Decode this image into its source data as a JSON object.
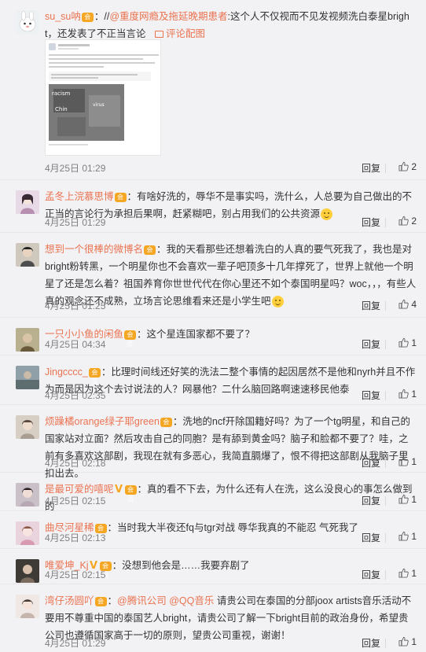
{
  "ui": {
    "reply_label": "回复",
    "accent": "#eb7350",
    "emoji_icon": "smile-emoji-icon"
  },
  "comments": [
    {
      "user": "su_su呐",
      "badge": "会员",
      "text_pre": "：//",
      "mention": "@重度网瘾及拖延晚期患者",
      "text": ":这个人不仅视而不见发视频洗白泰星bright，还发表了不正当言论",
      "pic_link": "评论配图",
      "time": "4月25日 01:29",
      "likes": "2"
    },
    {
      "user": "孟冬上浣慕思博",
      "badge": "会员",
      "text": "：有啥好洗的，辱华不是事实吗，洗什么，人总要为自己做出的不正当的言论行为承担后果啊，赶紧糊吧，别占用我们的公共资源",
      "time": "4月25日 01:29",
      "likes": "2"
    },
    {
      "user": "想到一个很棒的微博名",
      "badge": "会员",
      "text": "：我的天看那些还想着洗白的人真的要气死我了，我也是对bright粉转黑，一个明星你也不会喜欢一辈子吧顶多十几年撑死了，世界上就他一个明星了还是怎么着？祖国养育你世世代代在你心里还不如个泰国明星吗？woc，，，有些人真的观念还不成熟，立场言论思维看来还是小学生吧",
      "time": "4月25日 01:25",
      "likes": "4"
    },
    {
      "user": "一只小小鱼的闲鱼",
      "badge": "会员",
      "text": "：这个星连国家都不要了？",
      "time": "4月25日 04:34",
      "likes": "1"
    },
    {
      "user": "Jingcccc_",
      "badge": "会员",
      "text": "：比理时间线还好笑的洗法二整个事情的起因居然不是他和nyrh并且不作为而是因为这个去讨说法的人？网暴他？二什么脑回路啊速速移民他泰",
      "time": "4月25日 02:35",
      "likes": "1"
    },
    {
      "user": "烦躁橘orange绿子耶green",
      "badge": "会员",
      "text": "：洗地的ncf开除国籍好吗？为了一个tg明星，和自己的国家站对立面？然后攻击自己的同胞？是有舔到黄金吗？脑子和脸都不要了？哇，之前有多喜欢这部剧，我现在就有多恶心，我简直膈爆了，恨不得把这部剧从我脑子里扣出去。",
      "time": "4月25日 02:18",
      "likes": "1"
    },
    {
      "user": "是最可爱的嘻呢",
      "badge": "会员",
      "vip": "V",
      "text": "：真的看不下去，为什么还有人在洗，这么没良心的事怎么做到的",
      "time": "4月25日 02:15",
      "likes": "1"
    },
    {
      "user": "曲尽河星稀",
      "badge": "会员",
      "text": "：当时我大半夜还fq与tgr对战 辱华我真的不能忍 气死我了",
      "time": "4月25日 02:13",
      "likes": "1"
    },
    {
      "user": "唯爱坤_Kj",
      "badge": "会员",
      "vip": "V",
      "text": "：没想到他会是……我要弃剧了",
      "time": "4月25日 02:15",
      "likes": "1"
    },
    {
      "user": "湾仔汤圆吖",
      "badge": "会员",
      "text_pre": "：",
      "mention": "@腾讯公司",
      "mention2": "@QQ音乐",
      "text": " 请贵公司在泰国的分部joox artists音乐活动不要用不尊重中国的泰国艺人bright，请贵公司了解一下bright目前的政治身份，希望贵公司也遵循国家高于一切的原则，望贵公司重视，谢谢！",
      "time": "4月25日 01:29",
      "likes": "1"
    }
  ],
  "screenshot": {
    "lines": [
      "【正义提醒】网友反映，最近BTS的MV（新歌）中出现辱华内容，请大家注意辨别！",
      "请问bright是否支持台独"
    ],
    "question": "你们觉得呢？"
  }
}
